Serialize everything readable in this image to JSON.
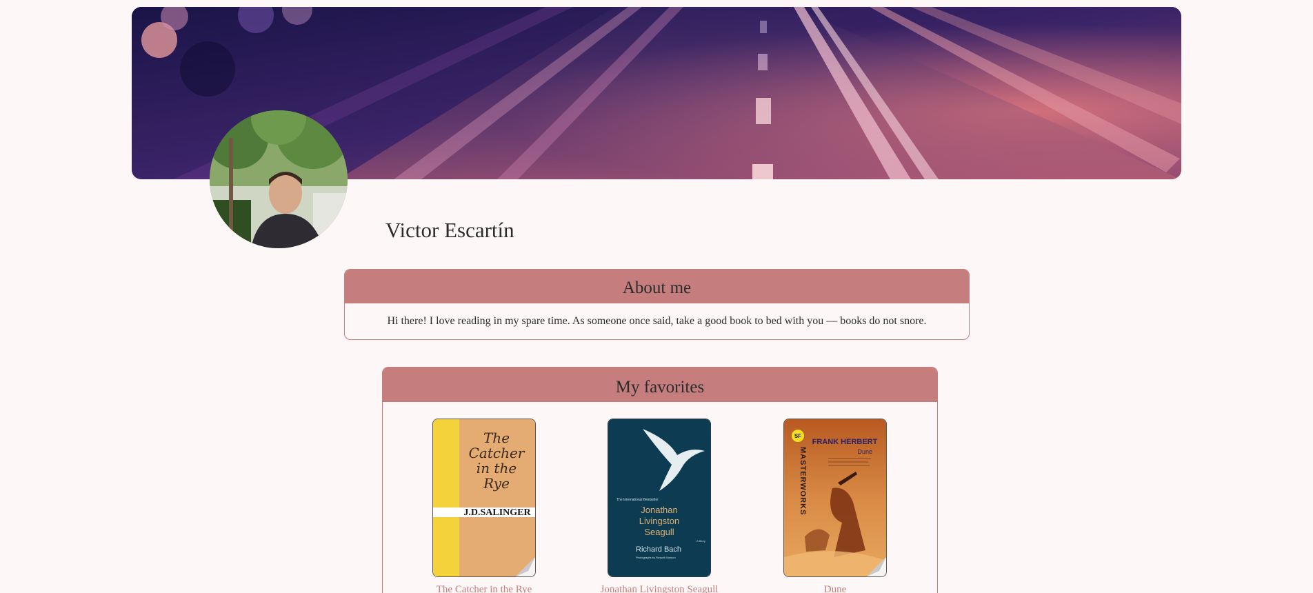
{
  "profile": {
    "name": "Victor Escartín"
  },
  "about": {
    "heading": "About me",
    "text": "Hi there! I love reading in my spare time. As someone once said, take a good book to bed with you — books do not snore."
  },
  "favorites": {
    "heading": "My favorites",
    "books": [
      {
        "title": "The Catcher in the Rye",
        "cover_lines": [
          "The",
          "Catcher",
          "in the",
          "Rye"
        ],
        "cover_author": "J.D.SALINGER"
      },
      {
        "title": "Jonathan Livingston Seagull",
        "cover_tagline": "The International Bestseller",
        "cover_lines": [
          "Jonathan",
          "Livingston",
          "Seagull"
        ],
        "cover_author": "Richard Bach",
        "cover_credit": "Photographs by Russell Munson",
        "cover_badge": "A Story"
      },
      {
        "title": "Dune",
        "cover_badge": "SF",
        "cover_series": "MASTERWORKS",
        "cover_author": "FRANK HERBERT",
        "cover_lines": [
          "Dune"
        ]
      }
    ]
  },
  "colors": {
    "accent": "#c57d7d",
    "background": "#fdf8f7",
    "text": "#2b2b2b"
  }
}
